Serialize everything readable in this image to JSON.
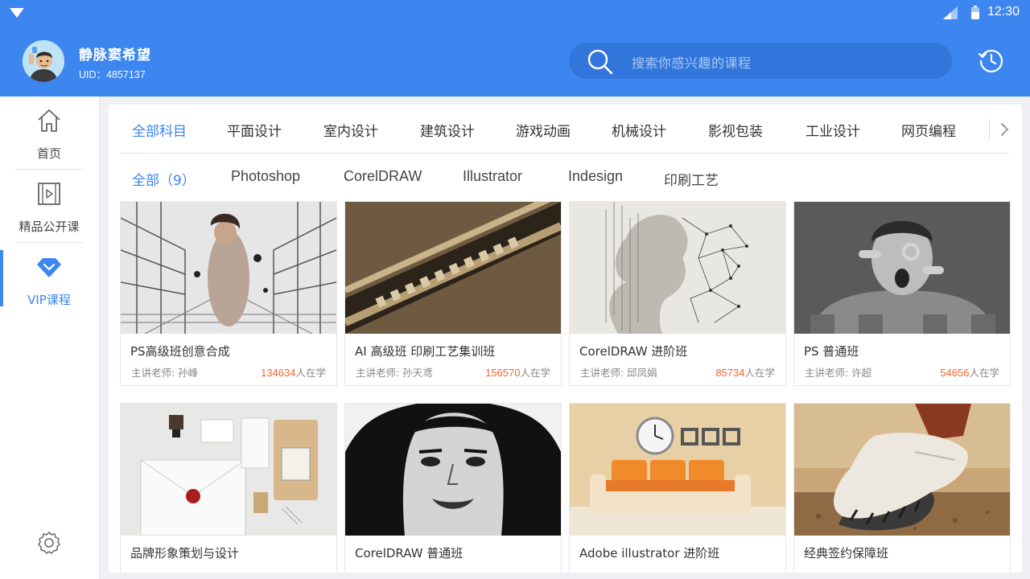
{
  "status_bar": {
    "time": "12:30"
  },
  "user": {
    "name": "静脉窦希望",
    "uid": "UID：4857137"
  },
  "search": {
    "placeholder": "搜索你感兴趣的课程"
  },
  "sidebar": {
    "items": [
      {
        "label": "首页",
        "icon": "home-icon",
        "active": false
      },
      {
        "label": "精品公开课",
        "icon": "video-icon",
        "active": false
      },
      {
        "label": "VIP课程",
        "icon": "diamond-icon",
        "active": true
      }
    ]
  },
  "category_tabs": [
    "全部科目",
    "平面设计",
    "室内设计",
    "建筑设计",
    "游戏动画",
    "机械设计",
    "影视包装",
    "工业设计",
    "网页编程"
  ],
  "sub_tabs": [
    "全部（9）",
    "Photoshop",
    "CorelDRAW",
    "Illustrator",
    "Indesign",
    "印刷工艺"
  ],
  "colors": {
    "primary": "#3d86ef",
    "learners_count": "#f0642c"
  },
  "courses": [
    {
      "title": "PS高级班创意合成",
      "teacher": "主讲老师: 孙峰",
      "count": "134634",
      "suffix": "人在学"
    },
    {
      "title": "AI 高级班 印刷工艺集训班",
      "teacher": "主讲老师: 孙天鸢",
      "count": "156570",
      "suffix": "人在学"
    },
    {
      "title": "CorelDRAW 进阶班",
      "teacher": "主讲老师: 邱凤娟",
      "count": "85734",
      "suffix": "人在学"
    },
    {
      "title": "PS 普通班",
      "teacher": "主讲老师: 许超",
      "count": "54656",
      "suffix": "人在学"
    },
    {
      "title": "品牌形象策划与设计"
    },
    {
      "title": "CorelDRAW 普通班"
    },
    {
      "title": "Adobe illustrator 进阶班"
    },
    {
      "title": "经典签约保障班"
    }
  ]
}
